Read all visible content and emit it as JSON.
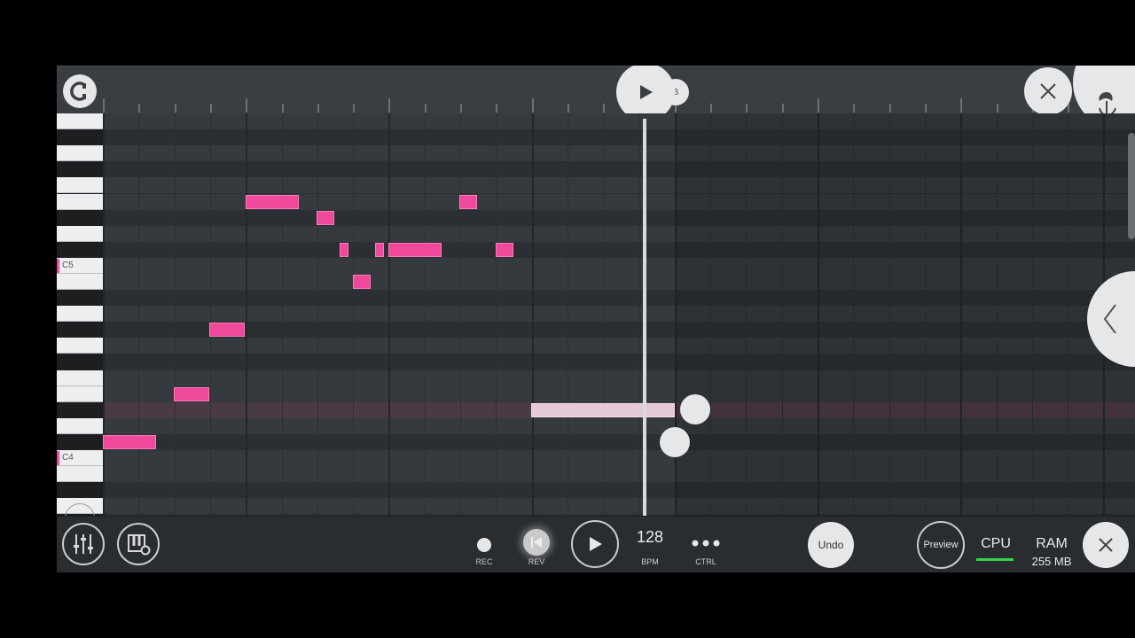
{
  "piano": {
    "c5_label": "C5",
    "c4_label": "C4"
  },
  "transport": {
    "rec_label": "REC",
    "rev_label": "REV",
    "tempo_value": "128",
    "tempo_label": "BPM",
    "ctrl_label": "CTRL",
    "undo_label": "Undo",
    "preview_label": "Preview",
    "cpu_label": "CPU",
    "ram_label": "RAM",
    "ram_value": "255 MB"
  },
  "colors": {
    "note": "#f0489a",
    "ghost_note": "#e6c9d8",
    "cpu_meter": "#36d44a"
  }
}
